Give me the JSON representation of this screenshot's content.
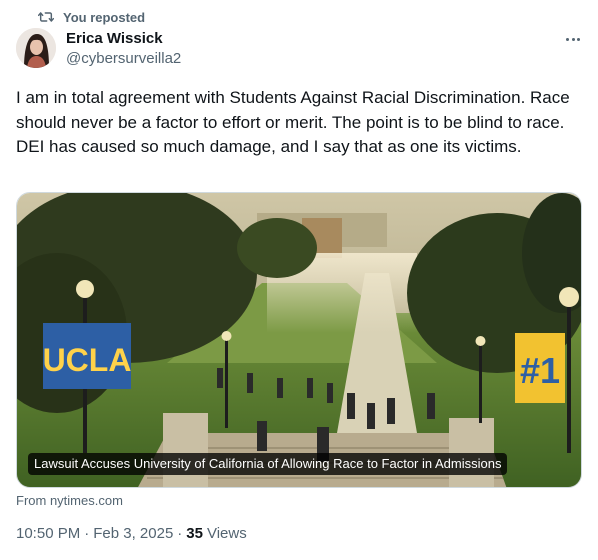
{
  "repost": {
    "label": "You reposted",
    "icon": "repost-icon"
  },
  "author": {
    "name": "Erica Wissick",
    "handle": "@cybersurveilla2"
  },
  "more_icon": "more-icon",
  "post": {
    "text": "I am in total agreement with Students Against Racial Discrimination. Race should never be a factor to effort or merit. The point is to be blind to race. DEI has caused so much damage, and I say that as one its victims."
  },
  "card": {
    "caption": "Lawsuit Accuses University of California of Allowing Race to Factor in Admissions",
    "banner_left": "UCLA",
    "banner_right": "#1",
    "source": "From nytimes.com"
  },
  "meta": {
    "time": "10:50 PM",
    "sep1": "·",
    "date": "Feb 3, 2025",
    "sep2": "·",
    "views_count": "35",
    "views_label": "Views"
  },
  "colors": {
    "text_primary": "#0f1419",
    "text_secondary": "#536471",
    "border": "#cfd9de"
  }
}
